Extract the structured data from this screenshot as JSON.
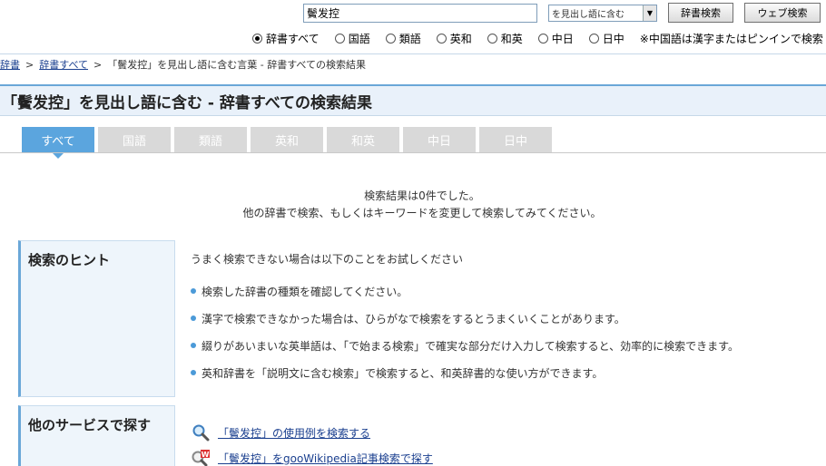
{
  "search": {
    "query": "鬢发控",
    "mode": "を見出し語に含む",
    "dict_button": "辞書検索",
    "web_button": "ウェブ検索"
  },
  "radios": [
    {
      "label": "辞書すべて",
      "checked": true
    },
    {
      "label": "国語",
      "checked": false
    },
    {
      "label": "類語",
      "checked": false
    },
    {
      "label": "英和",
      "checked": false
    },
    {
      "label": "和英",
      "checked": false
    },
    {
      "label": "中日",
      "checked": false
    },
    {
      "label": "日中",
      "checked": false
    }
  ],
  "radio_note": "※中国語は漢字またはピンインで検索",
  "breadcrumb": {
    "item1": "辞書",
    "item2": "辞書すべて",
    "current": "「鬢发控」を見出し語に含む言葉 - 辞書すべての検索結果",
    "separator": ">"
  },
  "title": "「鬢发控」を見出し語に含む - 辞書すべての検索結果",
  "tabs": [
    "すべて",
    "国語",
    "類語",
    "英和",
    "和英",
    "中日",
    "日中"
  ],
  "result": {
    "line1": "検索結果は0件でした。",
    "line2": "他の辞書で検索、もしくはキーワードを変更して検索してみてください。"
  },
  "hints": {
    "label": "検索のヒント",
    "intro": "うまく検索できない場合は以下のことをお試しください",
    "items": [
      "検索した辞書の種類を確認してください。",
      "漢字で検索できなかった場合は、ひらがなで検索をするとうまくいくことがあります。",
      "綴りがあいまいな英単語は、「で始まる検索」で確実な部分だけ入力して検索すると、効率的に検索できます。",
      "英和辞書を「説明文に含む検索」で検索すると、和英辞書的な使い方ができます。"
    ]
  },
  "services": {
    "label": "他のサービスで探す",
    "links": [
      {
        "text": "「鬢发控」の使用例を検索する",
        "icon": "magnifier-icon"
      },
      {
        "text": "「鬢发控」をgooWikipedia記事検索で探す",
        "icon": "wikipedia-search-icon"
      }
    ]
  },
  "colors": {
    "accent": "#5ba5de",
    "link": "#1a3f8f",
    "title_bg": "#e9f1fa",
    "tab_inactive": "#d9d9d9"
  }
}
